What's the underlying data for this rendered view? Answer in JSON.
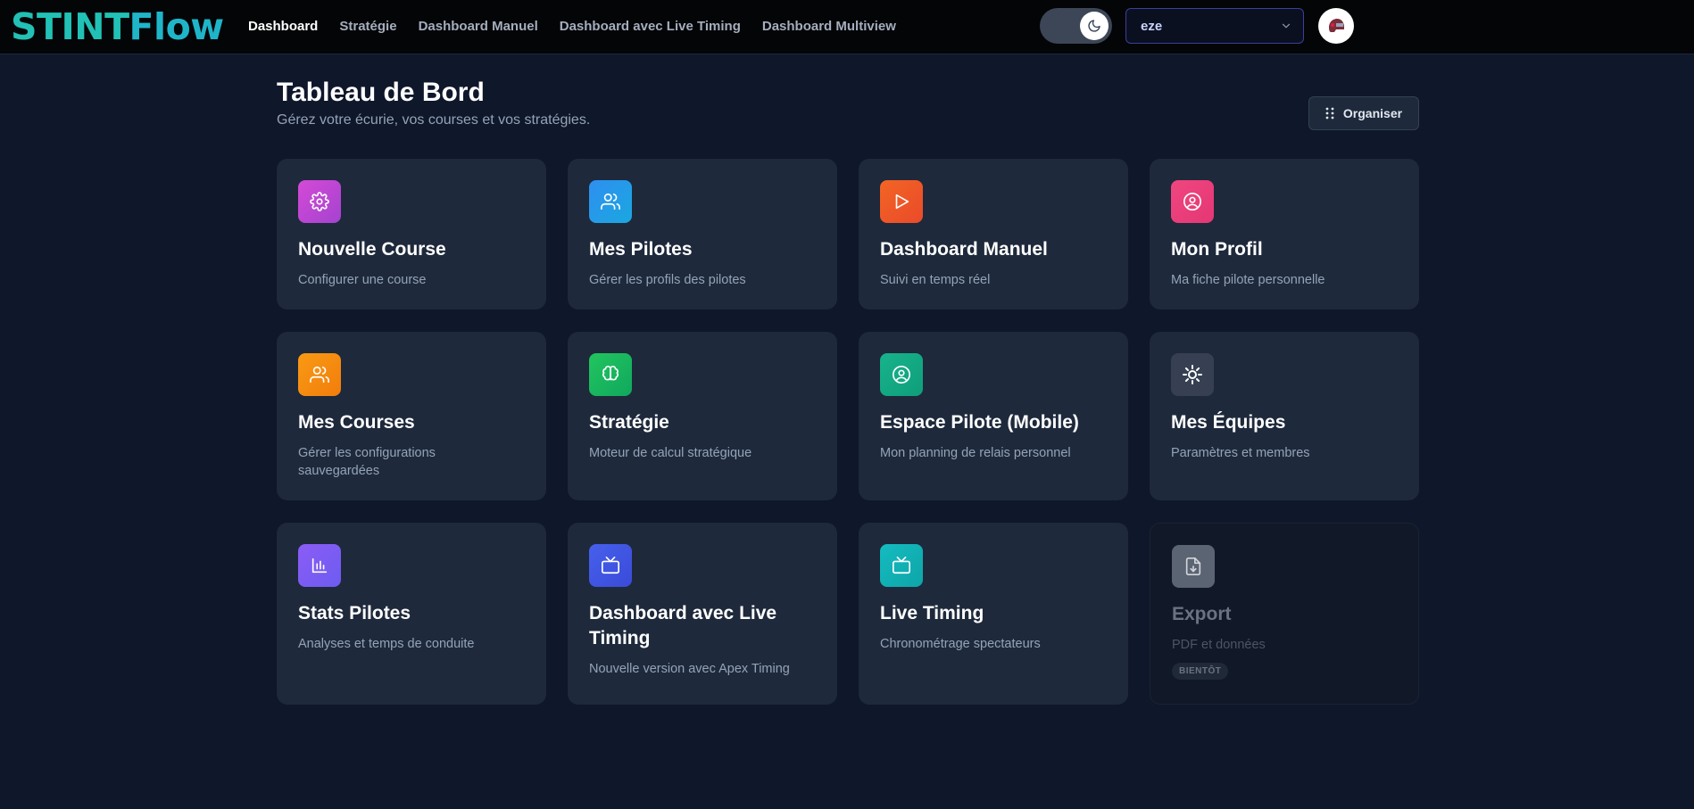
{
  "brand": {
    "logo_part1": "STINT",
    "logo_part2": "Flow"
  },
  "nav": [
    {
      "label": "Dashboard",
      "active": true
    },
    {
      "label": "Stratégie",
      "active": false
    },
    {
      "label": "Dashboard Manuel",
      "active": false
    },
    {
      "label": "Dashboard avec Live Timing",
      "active": false
    },
    {
      "label": "Dashboard Multiview",
      "active": false
    }
  ],
  "theme_toggle": {
    "mode": "dark",
    "icon": "moon-icon"
  },
  "team_select": {
    "value": "eze"
  },
  "header": {
    "title": "Tableau de Bord",
    "subtitle": "Gérez votre écurie, vos courses et vos stratégies.",
    "organize_label": "Organiser"
  },
  "cards": [
    {
      "title": "Nouvelle Course",
      "desc": "Configurer une course",
      "icon": "gear-icon",
      "color": "#c046d3"
    },
    {
      "title": "Mes Pilotes",
      "desc": "Gérer les profils des pilotes",
      "icon": "users-icon",
      "color": "#1e9be6"
    },
    {
      "title": "Dashboard Manuel",
      "desc": "Suivi en temps réel",
      "icon": "play-icon",
      "color": "#f05a24"
    },
    {
      "title": "Mon Profil",
      "desc": "Ma fiche pilote personnelle",
      "icon": "user-circle-icon",
      "color": "#ec3f7c"
    },
    {
      "title": "Mes Courses",
      "desc": "Gérer les configurations sauvegardées",
      "icon": "users-icon",
      "color": "#f58a0b"
    },
    {
      "title": "Stratégie",
      "desc": "Moteur de calcul stratégique",
      "icon": "brain-icon",
      "color": "#19b566"
    },
    {
      "title": "Espace Pilote (Mobile)",
      "desc": "Mon planning de relais personnel",
      "icon": "user-circle-icon",
      "color": "#12a884"
    },
    {
      "title": "Mes Équipes",
      "desc": "Paramètres et membres",
      "icon": "cog-icon",
      "color": "#3a4456"
    },
    {
      "title": "Stats Pilotes",
      "desc": "Analyses et temps de conduite",
      "icon": "bar-chart-icon",
      "color": "#7a5cf0"
    },
    {
      "title": "Dashboard avec Live Timing",
      "desc": "Nouvelle version avec Apex Timing",
      "icon": "tv-icon",
      "color": "#3d54e0"
    },
    {
      "title": "Live Timing",
      "desc": "Chronométrage spectateurs",
      "icon": "tv-icon",
      "color": "#10b4b8"
    },
    {
      "title": "Export",
      "desc": "PDF et données",
      "icon": "file-download-icon",
      "color": "#5b6472",
      "badge": "BIENTÔT",
      "disabled": true
    }
  ]
}
